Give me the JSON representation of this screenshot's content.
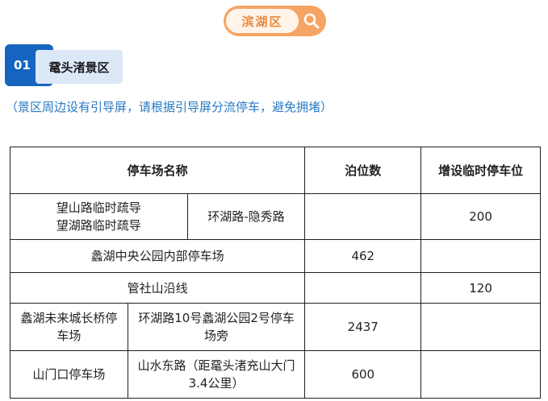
{
  "district": {
    "label": "滨湖区",
    "icon": "search-icon",
    "color": "#f6a463"
  },
  "section": {
    "number": "01",
    "title": "鼋头渚景区",
    "accent": "#1565c0"
  },
  "note": "（景区周边设有引导屏，请根据引导屏分流停车，避免拥堵）",
  "table": {
    "headers": {
      "name": "停车场名称",
      "spaces": "泊位数",
      "temp": "增设临时停车位"
    },
    "rows": [
      {
        "name_line1": "望山路临时疏导",
        "name_line2": "望湖路临时疏导",
        "location": "环湖路-隐秀路",
        "spaces": "",
        "temp": "200"
      },
      {
        "name": "蠡湖中央公园内部停车场",
        "spaces": "462",
        "temp": ""
      },
      {
        "name": "管社山沿线",
        "spaces": "",
        "temp": "120"
      },
      {
        "name": "蠡湖未来城长桥停车场",
        "location": "环湖路10号蠡湖公园2号停车场旁",
        "spaces": "2437",
        "temp": ""
      },
      {
        "name": "山门口停车场",
        "location": "山水东路（距鼋头渚充山大门3.4公里）",
        "spaces": "600",
        "temp": ""
      }
    ]
  }
}
